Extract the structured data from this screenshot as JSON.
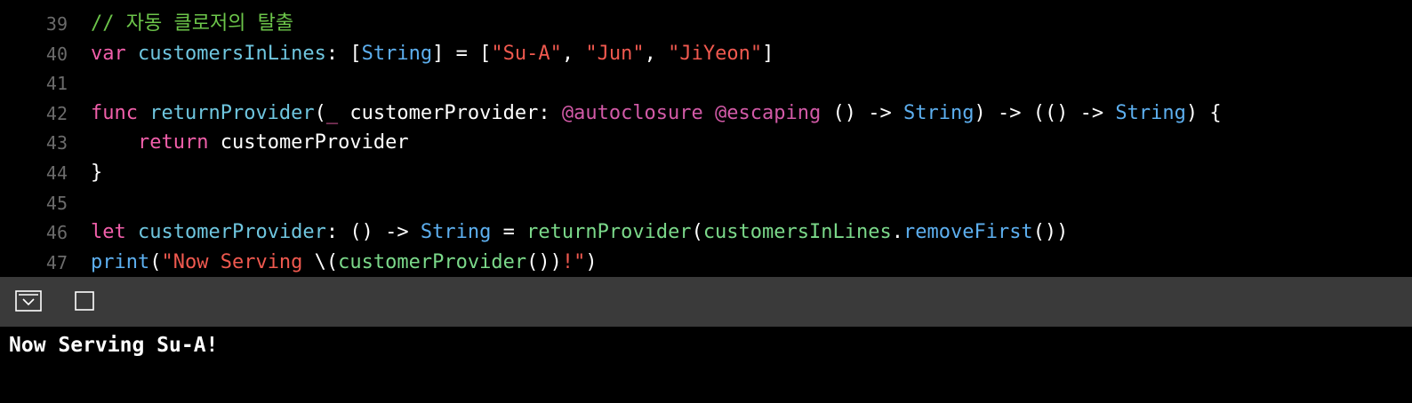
{
  "editor": {
    "lines": [
      {
        "number": "39",
        "tokens": [
          {
            "text": "// 자동 클로저의 탈출",
            "kind": "comment"
          }
        ]
      },
      {
        "number": "40",
        "tokens": [
          {
            "text": "var",
            "kind": "kw"
          },
          {
            "text": " ",
            "kind": "plain"
          },
          {
            "text": "customersInLines",
            "kind": "decl"
          },
          {
            "text": ": [",
            "kind": "plain"
          },
          {
            "text": "String",
            "kind": "type"
          },
          {
            "text": "] = [",
            "kind": "plain"
          },
          {
            "text": "\"Su-A\"",
            "kind": "str"
          },
          {
            "text": ", ",
            "kind": "plain"
          },
          {
            "text": "\"Jun\"",
            "kind": "str"
          },
          {
            "text": ", ",
            "kind": "plain"
          },
          {
            "text": "\"JiYeon\"",
            "kind": "str"
          },
          {
            "text": "]",
            "kind": "plain"
          }
        ]
      },
      {
        "number": "41",
        "tokens": []
      },
      {
        "number": "42",
        "tokens": [
          {
            "text": "func",
            "kind": "kw"
          },
          {
            "text": " ",
            "kind": "plain"
          },
          {
            "text": "returnProvider",
            "kind": "decl"
          },
          {
            "text": "(",
            "kind": "plain"
          },
          {
            "text": "_",
            "kind": "kw"
          },
          {
            "text": " customerProvider: ",
            "kind": "plain"
          },
          {
            "text": "@autoclosure",
            "kind": "attr"
          },
          {
            "text": " ",
            "kind": "plain"
          },
          {
            "text": "@escaping",
            "kind": "attr"
          },
          {
            "text": " () -> ",
            "kind": "plain"
          },
          {
            "text": "String",
            "kind": "type"
          },
          {
            "text": ") -> (() -> ",
            "kind": "plain"
          },
          {
            "text": "String",
            "kind": "type"
          },
          {
            "text": ") {",
            "kind": "plain"
          }
        ]
      },
      {
        "number": "43",
        "tokens": [
          {
            "text": "    ",
            "kind": "plain"
          },
          {
            "text": "return",
            "kind": "kw"
          },
          {
            "text": " customerProvider",
            "kind": "plain"
          }
        ]
      },
      {
        "number": "44",
        "tokens": [
          {
            "text": "}",
            "kind": "plain"
          }
        ]
      },
      {
        "number": "45",
        "tokens": []
      },
      {
        "number": "46",
        "tokens": [
          {
            "text": "let",
            "kind": "kw"
          },
          {
            "text": " ",
            "kind": "plain"
          },
          {
            "text": "customerProvider",
            "kind": "decl"
          },
          {
            "text": ": () -> ",
            "kind": "plain"
          },
          {
            "text": "String",
            "kind": "type"
          },
          {
            "text": " = ",
            "kind": "plain"
          },
          {
            "text": "returnProvider",
            "kind": "call"
          },
          {
            "text": "(",
            "kind": "plain"
          },
          {
            "text": "customersInLines",
            "kind": "call"
          },
          {
            "text": ".",
            "kind": "plain"
          },
          {
            "text": "removeFirst",
            "kind": "type"
          },
          {
            "text": "())",
            "kind": "plain"
          }
        ]
      },
      {
        "number": "47",
        "tokens": [
          {
            "text": "print",
            "kind": "type"
          },
          {
            "text": "(",
            "kind": "plain"
          },
          {
            "text": "\"Now Serving ",
            "kind": "str"
          },
          {
            "text": "\\(",
            "kind": "plain"
          },
          {
            "text": "customerProvider",
            "kind": "call"
          },
          {
            "text": "())",
            "kind": "plain"
          },
          {
            "text": "!\"",
            "kind": "str"
          },
          {
            "text": ")",
            "kind": "plain"
          }
        ]
      }
    ]
  },
  "debug_bar": {
    "hide_console_icon": "hide-debug-area-icon",
    "console_toggle_icon": "console-toggle-icon"
  },
  "console": {
    "output": "Now Serving Su-A!"
  },
  "colors": {
    "background": "#000000",
    "comment": "#6cc54a",
    "keyword": "#f15faa",
    "type": "#5dafef",
    "declaration": "#6fc6df",
    "string": "#f0594f",
    "call": "#7bd98a",
    "attribute": "#d25aa7",
    "debug_bar": "#3a3a3a"
  }
}
